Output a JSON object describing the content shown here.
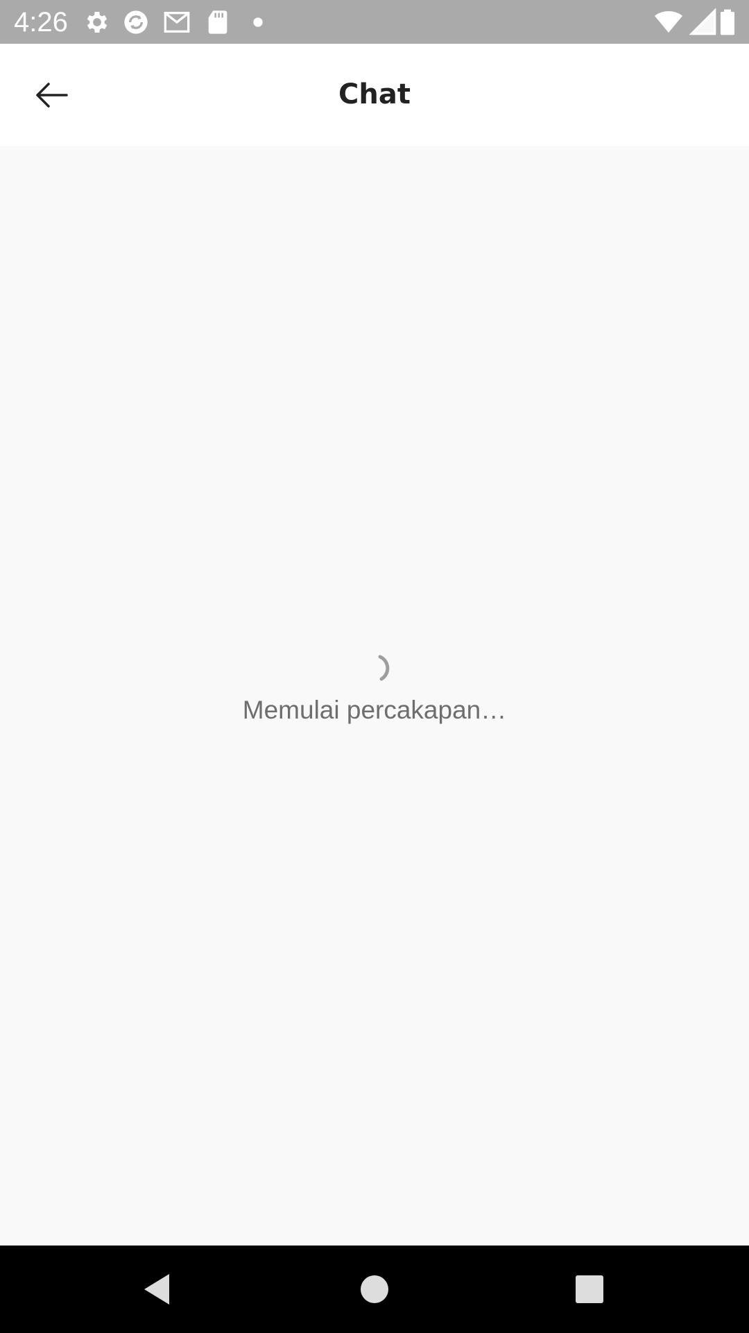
{
  "status_bar": {
    "time": "4:26",
    "icons": [
      "gear-icon",
      "sync-icon",
      "gmail-icon",
      "sd-card-icon",
      "dot-icon",
      "wifi-icon",
      "signal-icon",
      "battery-icon"
    ]
  },
  "app_bar": {
    "title": "Chat",
    "back_icon": "arrow-left-icon"
  },
  "content": {
    "loading_text": "Memulai percakapan…",
    "spinner_icon": "spinner-icon"
  },
  "nav_bar": {
    "buttons": [
      "back-triangle-icon",
      "home-circle-icon",
      "recents-square-icon"
    ]
  },
  "colors": {
    "status_bar": "#aaaaaa",
    "app_bar": "#ffffff",
    "background": "#f9f9f9",
    "title_text": "#222222",
    "loading_text": "#6e6e6e",
    "nav_bar": "#000000"
  }
}
